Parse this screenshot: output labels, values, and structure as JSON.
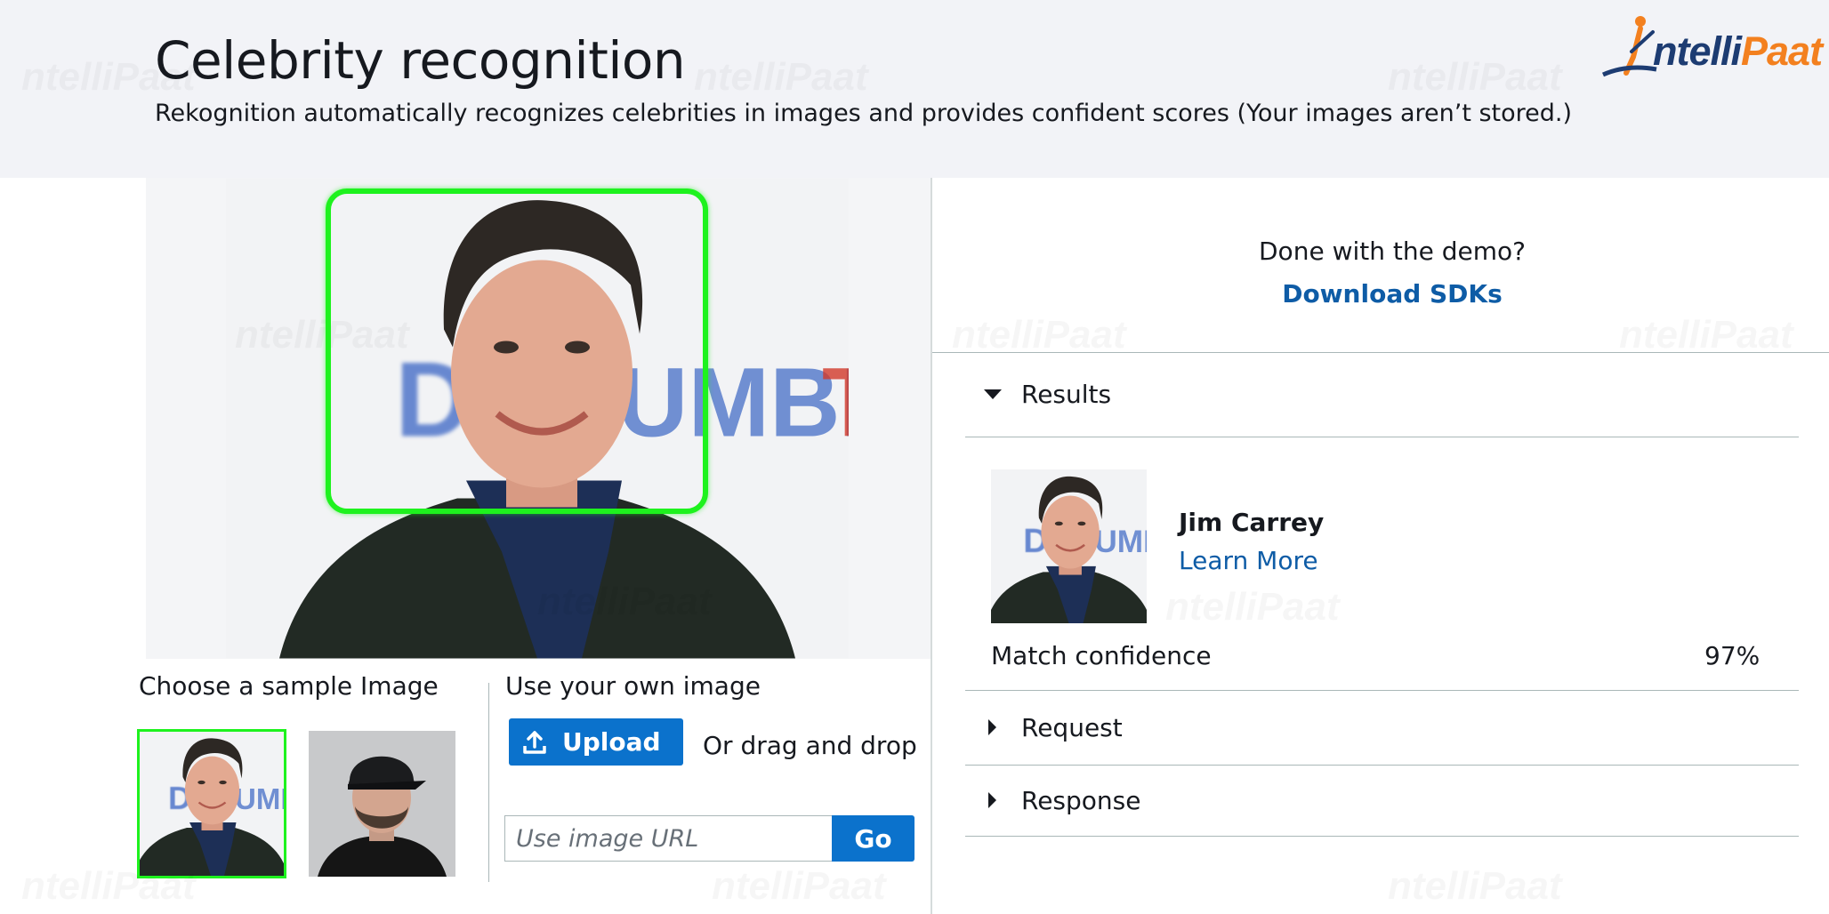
{
  "header": {
    "title": "Celebrity recognition",
    "subtitle": "Rekognition automatically recognizes celebrities in images and provides confident scores (Your images aren’t stored.)"
  },
  "logo": {
    "text_a": "ntelli",
    "text_b": "Paat",
    "colors": {
      "navy": "#1d3c72",
      "orange": "#f3801f"
    }
  },
  "watermark_text": "ntelliPaat",
  "left_panel": {
    "sample_label": "Choose a sample Image",
    "own_image_label": "Use your own image",
    "upload_label": "Upload",
    "drag_text": "Or drag and drop",
    "url_placeholder": "Use image URL",
    "go_label": "Go"
  },
  "right_panel": {
    "done_question": "Done with the demo?",
    "download_link": "Download SDKs",
    "results_label": "Results",
    "celebrity_name": "Jim Carrey",
    "learn_more": "Learn More",
    "confidence_label": "Match confidence",
    "confidence_value": "97%",
    "request_label": "Request",
    "response_label": "Response"
  },
  "colors": {
    "header_bg": "#f2f3f7",
    "primary_button": "#0b72cc",
    "link": "#0e5ca6",
    "detection_box": "#1ef21e"
  }
}
